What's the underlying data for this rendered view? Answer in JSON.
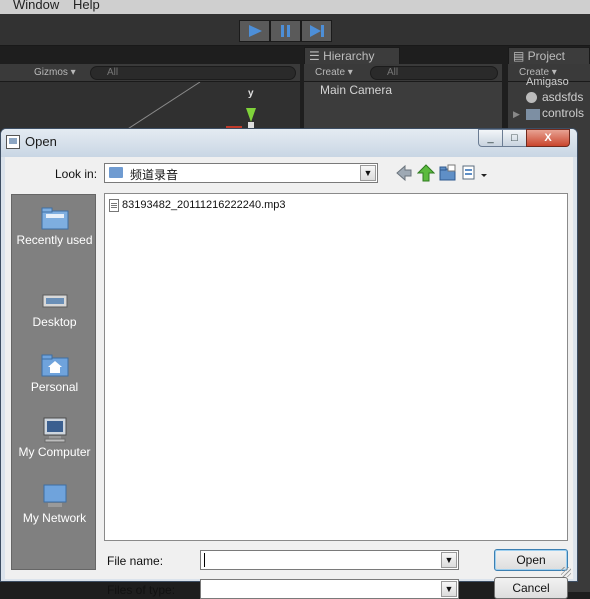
{
  "menubar": {
    "items": [
      "Window",
      "Help"
    ]
  },
  "scene": {
    "gizmos_label": "Gizmos",
    "search_placeholder": "All",
    "axis_label": "y"
  },
  "hierarchy": {
    "tab_label": "Hierarchy",
    "create_label": "Create",
    "search_placeholder": "All",
    "items": [
      "Main Camera"
    ]
  },
  "project": {
    "tab_label": "Project",
    "create_label": "Create",
    "items": [
      "Amigaso",
      "asdsfds",
      "controls"
    ]
  },
  "dialog": {
    "title": "Open",
    "look_in_label": "Look in:",
    "look_in_value": "频道录音",
    "places": [
      "Recently used",
      "Desktop",
      "Personal",
      "My Computer",
      "My Network"
    ],
    "files": [
      "83193482_20111216222240.mp3"
    ],
    "file_name_label": "File name:",
    "file_name_value": "",
    "files_of_type_label": "Files of type:",
    "files_of_type_value": "",
    "open_button": "Open",
    "cancel_button": "Cancel",
    "window_buttons": {
      "minimize": "_",
      "maximize": "□",
      "close": "X"
    }
  },
  "colors": {
    "unity_bg": "#1e1e1e",
    "dialog_face": "#f0f0f0",
    "places_bar": "#808080",
    "play_accent": "#4d8fd8"
  }
}
